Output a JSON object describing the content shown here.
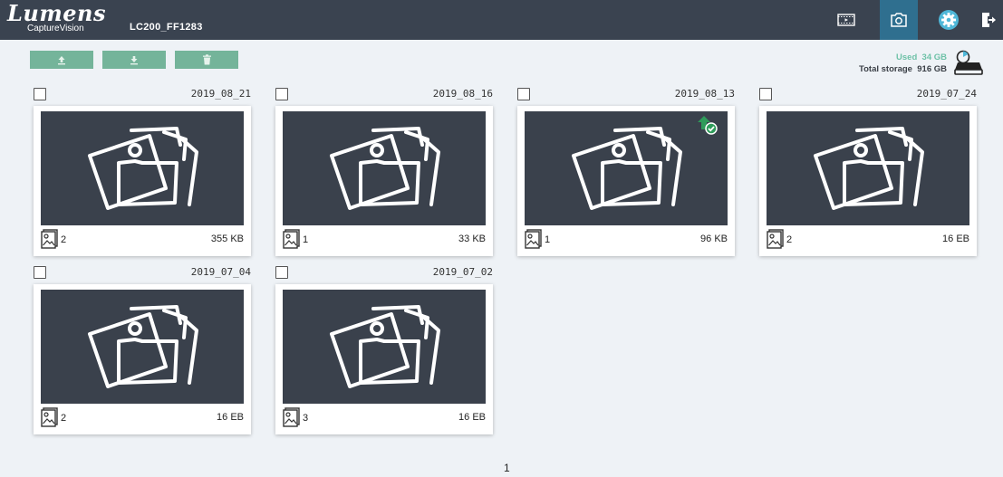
{
  "header": {
    "logo_main": "Lumens",
    "logo_sub": "CaptureVision",
    "device_name": "LC200_FF1283",
    "buttons": [
      {
        "name": "video-mode-button",
        "icon": "film-icon",
        "active": false
      },
      {
        "name": "photo-mode-button",
        "icon": "camera-icon",
        "active": true
      },
      {
        "name": "settings-button",
        "icon": "gear-icon",
        "active": false
      },
      {
        "name": "logout-button",
        "icon": "exit-icon",
        "active": false
      }
    ]
  },
  "toolbar": {
    "buttons": [
      {
        "name": "upload-button",
        "icon": "upload-icon"
      },
      {
        "name": "download-button",
        "icon": "download-icon"
      },
      {
        "name": "delete-button",
        "icon": "trash-icon"
      }
    ],
    "color": "#74b49a"
  },
  "storage": {
    "used_label": "Used",
    "used_value": "34 GB",
    "total_label": "Total storage",
    "total_value": "916 GB"
  },
  "albums": [
    {
      "date": "2019_08_21",
      "count": "2",
      "size": "355 KB",
      "uploaded": false
    },
    {
      "date": "2019_08_16",
      "count": "1",
      "size": "33 KB",
      "uploaded": false
    },
    {
      "date": "2019_08_13",
      "count": "1",
      "size": "96 KB",
      "uploaded": true
    },
    {
      "date": "2019_07_24",
      "count": "2",
      "size": "16 EB",
      "uploaded": false
    },
    {
      "date": "2019_07_04",
      "count": "2",
      "size": "16 EB",
      "uploaded": false
    },
    {
      "date": "2019_07_02",
      "count": "3",
      "size": "16 EB",
      "uploaded": false
    }
  ],
  "pagination": {
    "current_page": "1"
  }
}
